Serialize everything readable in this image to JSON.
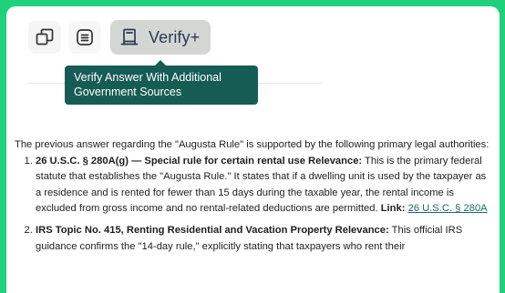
{
  "toolbar": {
    "copy_icon": "copy-icon",
    "list_icon": "list-icon",
    "verify_icon": "book-stand-icon",
    "verify_label": "Verify+"
  },
  "tooltip": {
    "text": "Verify Answer With Additional Government Sources"
  },
  "answer": {
    "intro": "The previous answer regarding the \"Augusta Rule\" is supported by the following primary legal authorities:",
    "items": [
      {
        "number": "1",
        "title": "26 U.S.C. § 280A(g) — Special rule for certain rental use Relevance:",
        "body": "This is the primary federal statute that establishes the \"Augusta Rule.\" It states that if a dwelling unit is used by the taxpayer as a residence and is rented for fewer than 15 days during the taxable year, the rental income is excluded from gross income and no rental-related deductions are permitted.",
        "link_label": "Link:",
        "link_text": "26 U.S.C. § 280A"
      },
      {
        "number": "2",
        "title": "IRS Topic No. 415, Renting Residential and Vacation Property Relevance:",
        "body": "This official IRS guidance confirms the \"14-day rule,\" explicitly stating that taxpayers who rent their"
      }
    ]
  },
  "colors": {
    "frame": "#1fd17a",
    "tooltip_bg": "#165c55",
    "verify_bg": "#d3d6d3",
    "link": "#1b6b64"
  }
}
